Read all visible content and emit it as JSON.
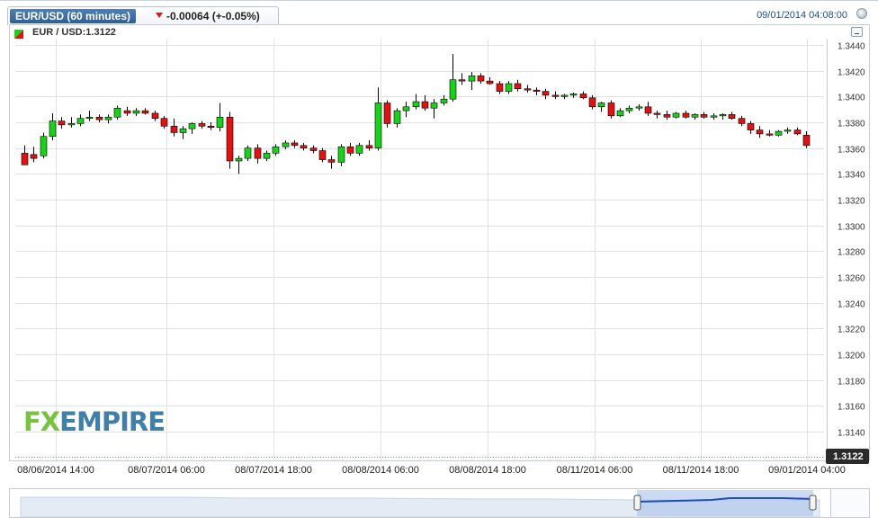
{
  "header": {
    "symbol_tab": "EUR/USD (60 minutes)",
    "change": "-0.00064 (+-0.05%)",
    "timestamp": "09/01/2014 04:08:00"
  },
  "legend": {
    "label": "EUR / USD:1.3122"
  },
  "logo": {
    "text_fx": "FX",
    "text_empire": "EMPIRE"
  },
  "current_price_label": "1.3122",
  "colors": {
    "up": "#19d119",
    "down": "#e01212",
    "grid": "#e2e2e2",
    "accent": "#1a4f8b"
  },
  "chart_data": {
    "type": "candlestick",
    "title": "EUR / USD:1.3122",
    "ylim": [
      1.3122,
      1.3445
    ],
    "y_ticks": [
      "1.3440",
      "1.3420",
      "1.3400",
      "1.3380",
      "1.3360",
      "1.3340",
      "1.3320",
      "1.3300",
      "1.3280",
      "1.3260",
      "1.3240",
      "1.3220",
      "1.3200",
      "1.3180",
      "1.3160",
      "1.3140"
    ],
    "x_ticks": [
      "08/06/2014 14:00",
      "08/07/2014 06:00",
      "08/07/2014 18:00",
      "08/08/2014 06:00",
      "08/08/2014 18:00",
      "08/11/2014 06:00",
      "08/11/2014 18:00",
      "09/01/2014 04:00"
    ],
    "current_price": 1.3122,
    "candles": [
      [
        1.3356,
        1.3362,
        1.3348,
        1.3347
      ],
      [
        1.3355,
        1.3361,
        1.3349,
        1.3352
      ],
      [
        1.3354,
        1.3372,
        1.3352,
        1.3369
      ],
      [
        1.3369,
        1.3387,
        1.3366,
        1.3381
      ],
      [
        1.3381,
        1.3384,
        1.3375,
        1.3378
      ],
      [
        1.3378,
        1.3384,
        1.3376,
        1.3379
      ],
      [
        1.3379,
        1.3386,
        1.3377,
        1.3383
      ],
      [
        1.3383,
        1.3389,
        1.3381,
        1.3384
      ],
      [
        1.3384,
        1.3386,
        1.338,
        1.3382
      ],
      [
        1.3382,
        1.3386,
        1.3379,
        1.3384
      ],
      [
        1.3384,
        1.3393,
        1.3382,
        1.3391
      ],
      [
        1.3389,
        1.3392,
        1.3385,
        1.3387
      ],
      [
        1.3387,
        1.3391,
        1.3385,
        1.3389
      ],
      [
        1.3389,
        1.3391,
        1.3386,
        1.3387
      ],
      [
        1.3387,
        1.3389,
        1.3381,
        1.3383
      ],
      [
        1.3383,
        1.3385,
        1.3375,
        1.3377
      ],
      [
        1.3377,
        1.3383,
        1.3369,
        1.3372
      ],
      [
        1.3372,
        1.3377,
        1.3367,
        1.3375
      ],
      [
        1.3375,
        1.338,
        1.3371,
        1.3379
      ],
      [
        1.3379,
        1.3381,
        1.3375,
        1.3377
      ],
      [
        1.3377,
        1.338,
        1.3374,
        1.3376
      ],
      [
        1.3376,
        1.3395,
        1.3373,
        1.3384
      ],
      [
        1.3384,
        1.3388,
        1.3344,
        1.335
      ],
      [
        1.335,
        1.3354,
        1.334,
        1.3352
      ],
      [
        1.3352,
        1.3362,
        1.335,
        1.336
      ],
      [
        1.336,
        1.3363,
        1.3348,
        1.3352
      ],
      [
        1.3352,
        1.3358,
        1.335,
        1.3356
      ],
      [
        1.3356,
        1.3363,
        1.3354,
        1.3361
      ],
      [
        1.3361,
        1.3366,
        1.3359,
        1.3364
      ],
      [
        1.3364,
        1.3366,
        1.336,
        1.3362
      ],
      [
        1.3362,
        1.3364,
        1.3358,
        1.336
      ],
      [
        1.336,
        1.3362,
        1.3356,
        1.3358
      ],
      [
        1.3358,
        1.336,
        1.3349,
        1.3351
      ],
      [
        1.3351,
        1.3354,
        1.3344,
        1.3349
      ],
      [
        1.3349,
        1.3363,
        1.3346,
        1.3361
      ],
      [
        1.3361,
        1.3364,
        1.3354,
        1.3356
      ],
      [
        1.3356,
        1.3364,
        1.3354,
        1.3362
      ],
      [
        1.3362,
        1.3366,
        1.3358,
        1.336
      ],
      [
        1.336,
        1.3407,
        1.3358,
        1.3395
      ],
      [
        1.3395,
        1.3397,
        1.3376,
        1.3379
      ],
      [
        1.3379,
        1.3391,
        1.3376,
        1.3389
      ],
      [
        1.3389,
        1.3396,
        1.3384,
        1.3392
      ],
      [
        1.3392,
        1.3402,
        1.339,
        1.3396
      ],
      [
        1.3396,
        1.3401,
        1.3389,
        1.3391
      ],
      [
        1.3391,
        1.3398,
        1.3383,
        1.3395
      ],
      [
        1.3395,
        1.3401,
        1.3393,
        1.3398
      ],
      [
        1.3398,
        1.3433,
        1.3396,
        1.3413
      ],
      [
        1.3413,
        1.3418,
        1.3409,
        1.3412
      ],
      [
        1.3412,
        1.3419,
        1.3405,
        1.3416
      ],
      [
        1.3416,
        1.3418,
        1.341,
        1.3412
      ],
      [
        1.3412,
        1.3415,
        1.3409,
        1.341
      ],
      [
        1.341,
        1.3412,
        1.3402,
        1.3404
      ],
      [
        1.3404,
        1.3412,
        1.3402,
        1.341
      ],
      [
        1.341,
        1.3413,
        1.3404,
        1.3406
      ],
      [
        1.3406,
        1.3409,
        1.3403,
        1.3405
      ],
      [
        1.3405,
        1.3407,
        1.3401,
        1.3404
      ],
      [
        1.3404,
        1.3406,
        1.3398,
        1.3401
      ],
      [
        1.3401,
        1.3404,
        1.3398,
        1.34
      ],
      [
        1.34,
        1.3402,
        1.3398,
        1.3401
      ],
      [
        1.3401,
        1.3403,
        1.3399,
        1.3402
      ],
      [
        1.3402,
        1.3404,
        1.3398,
        1.3399
      ],
      [
        1.3399,
        1.3401,
        1.339,
        1.3392
      ],
      [
        1.3392,
        1.3396,
        1.3388,
        1.3395
      ],
      [
        1.3395,
        1.3397,
        1.3383,
        1.3385
      ],
      [
        1.3385,
        1.3391,
        1.3384,
        1.3389
      ],
      [
        1.3389,
        1.3393,
        1.3387,
        1.3391
      ],
      [
        1.3391,
        1.3394,
        1.3389,
        1.3392
      ],
      [
        1.3392,
        1.3396,
        1.3385,
        1.3387
      ],
      [
        1.3387,
        1.3389,
        1.3383,
        1.3386
      ],
      [
        1.3386,
        1.3389,
        1.3382,
        1.3384
      ],
      [
        1.3384,
        1.3388,
        1.3383,
        1.3387
      ],
      [
        1.3387,
        1.3389,
        1.3383,
        1.3384
      ],
      [
        1.3384,
        1.3387,
        1.3382,
        1.3386
      ],
      [
        1.3386,
        1.3388,
        1.3383,
        1.3384
      ],
      [
        1.3384,
        1.3387,
        1.3382,
        1.3385
      ],
      [
        1.3385,
        1.3387,
        1.3382,
        1.3386
      ],
      [
        1.3386,
        1.3388,
        1.3382,
        1.3383
      ],
      [
        1.3383,
        1.3385,
        1.3377,
        1.3379
      ],
      [
        1.3379,
        1.3381,
        1.3371,
        1.3374
      ],
      [
        1.3374,
        1.3377,
        1.3368,
        1.3371
      ],
      [
        1.3371,
        1.3374,
        1.3369,
        1.337
      ],
      [
        1.337,
        1.3374,
        1.3369,
        1.3373
      ],
      [
        1.3373,
        1.3376,
        1.3371,
        1.3374
      ],
      [
        1.3374,
        1.3376,
        1.337,
        1.3371
      ],
      [
        1.337,
        1.3373,
        1.336,
        1.3362
      ]
    ]
  }
}
